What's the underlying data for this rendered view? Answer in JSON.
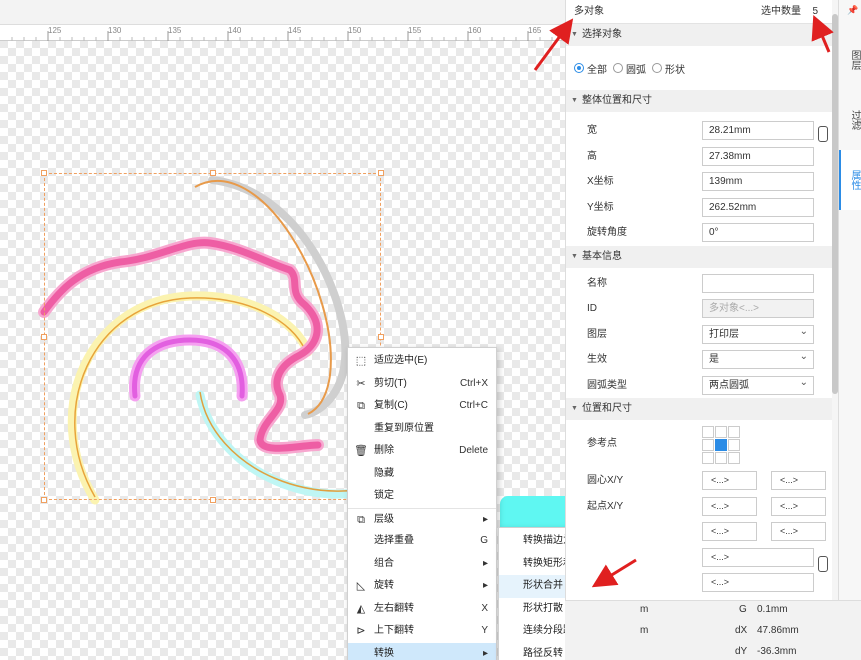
{
  "ruler": {
    "ticks": [
      "125",
      "130",
      "135",
      "140",
      "145",
      "150",
      "155",
      "160",
      "165"
    ]
  },
  "context_menu": {
    "items": [
      {
        "label": "适应选中(E)",
        "shortcut": "",
        "icon": "fit-icon"
      },
      {
        "label": "剪切(T)",
        "shortcut": "Ctrl+X",
        "icon": "scissors-icon"
      },
      {
        "label": "复制(C)",
        "shortcut": "Ctrl+C",
        "icon": "copy-icon"
      },
      {
        "label": "重复到原位置",
        "shortcut": "",
        "icon": ""
      },
      {
        "label": "删除",
        "shortcut": "Delete",
        "icon": "trash-icon"
      },
      {
        "label": "隐藏",
        "shortcut": "",
        "icon": ""
      },
      {
        "label": "锁定",
        "shortcut": "",
        "icon": ""
      },
      {
        "label": "层级",
        "shortcut": "▸",
        "icon": "layers-icon"
      },
      {
        "label": "选择重叠",
        "shortcut": "G",
        "icon": ""
      },
      {
        "label": "组合",
        "shortcut": "▸",
        "icon": ""
      },
      {
        "label": "旋转",
        "shortcut": "▸",
        "icon": "rotate-icon"
      },
      {
        "label": "左右翻转",
        "shortcut": "X",
        "icon": "flip-horizontal-icon"
      },
      {
        "label": "上下翻转",
        "shortcut": "Y",
        "icon": "flip-vertical-icon"
      },
      {
        "label": "转换",
        "shortcut": "▸",
        "icon": ""
      }
    ]
  },
  "submenu": {
    "items": [
      "转换描边为填充形状",
      "转换矩形和椭圆为路径",
      "形状合并",
      "形状打散",
      "连续分段路径连接",
      "路径反转"
    ]
  },
  "panel": {
    "title": "多对象",
    "selected_count_label": "选中数量",
    "selected_count": "5",
    "select_section": "选择对象",
    "radio": {
      "all": "全部",
      "arc": "圆弧",
      "shape": "形状",
      "selected": "all"
    },
    "overall_section": "整体位置和尺寸",
    "width_label": "宽",
    "width_value": "28.21mm",
    "height_label": "高",
    "height_value": "27.38mm",
    "x_label": "X坐标",
    "x_value": "139mm",
    "y_label": "Y坐标",
    "y_value": "262.52mm",
    "rotation_label": "旋转角度",
    "rotation_value": "0°",
    "basic_section": "基本信息",
    "name_label": "名称",
    "name_value": "",
    "id_label": "ID",
    "id_value": "多对象<...>",
    "layer_label": "图层",
    "layer_value": "打印层",
    "effect_label": "生效",
    "effect_value": "是",
    "arc_type_label": "圆弧类型",
    "arc_type_value": "两点圆弧",
    "posize_section": "位置和尺寸",
    "ref_point_label": "参考点",
    "center_label": "圆心X/Y",
    "start_label": "起点X/Y",
    "placeholder": "<...>"
  },
  "side_tabs": {
    "layers": "图层",
    "filter": "过滤",
    "properties": "属性"
  },
  "status": {
    "g_label": "G",
    "g_value": "0.1mm",
    "dx_label": "dX",
    "dx_value": "47.86mm",
    "dy_label": "dY",
    "dy_value": "-36.3mm",
    "unit1": "m",
    "unit2": "m"
  },
  "colors": {
    "accent": "#2b8ce6",
    "annotation": "#e02020",
    "pink": "#f06ab0",
    "orange": "#f0a040"
  }
}
